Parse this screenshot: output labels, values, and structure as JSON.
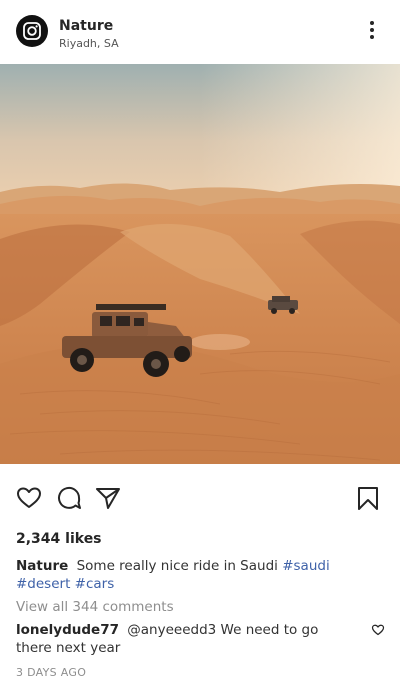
{
  "header": {
    "account_name": "Nature",
    "location": "Riyadh, SA",
    "avatar_icon": "instagram-logo-icon",
    "more_icon": "more-vertical-icon"
  },
  "post": {
    "image_alt": "Desert dunes with off-road vehicles",
    "likes": "2,344 likes",
    "caption_author": "Nature",
    "caption_text": "Some really nice ride in Saudi",
    "hashtags": [
      "#saudi",
      "#desert",
      "#cars"
    ],
    "view_comments": "View all 344 comments",
    "comment": {
      "author": "lonelydude77",
      "text": "@anyeeedd3 We need to go there next year"
    },
    "timestamp": "3 DAYS AGO"
  },
  "actions": {
    "like_icon": "heart-icon",
    "comment_icon": "comment-icon",
    "share_icon": "send-icon",
    "save_icon": "bookmark-icon"
  }
}
